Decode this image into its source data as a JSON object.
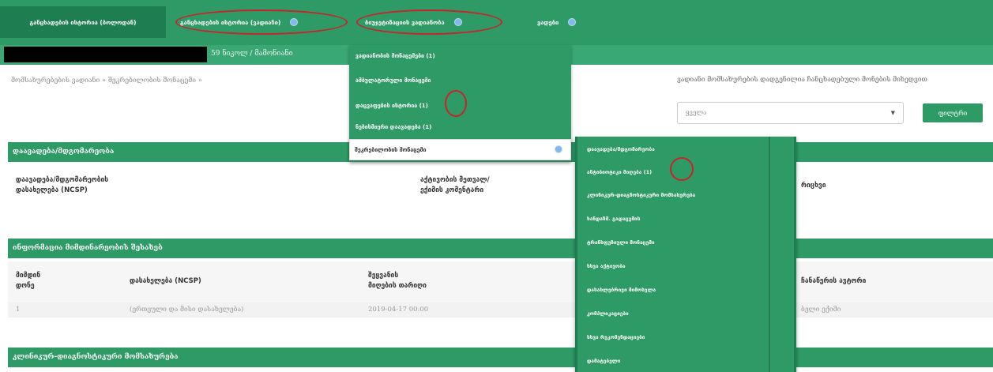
{
  "topnav": {
    "tabs": [
      {
        "label": "განცხადების ისტორია (ბოლოდან)"
      },
      {
        "label": "განცხადების ისტორია (ვადიანი)"
      },
      {
        "label": "ბიუჯეტიზაციის ვადიანობა"
      },
      {
        "label": "ვადები"
      }
    ]
  },
  "subnav": {
    "user_text": "59 ნიკოლ / მამონიანი"
  },
  "breadcrumb": "მომსახურებების ვადიანი » შეკრებილობის მონაცემი »",
  "filter": {
    "label": "ვადიანი მომსახურების დადგენილია ჩანცხადებული მონების მიხედვით",
    "select_value": "ყველა",
    "button_label": "ფილტრი"
  },
  "sections": {
    "section1_title": "დაავადება/მდგომარეობა",
    "section2_title": "ინფორმაცია მიმდინარეობის შესახებ",
    "section3_title": "კლინიკურ-დიაგნოსტიკური მომსახურება"
  },
  "section1": {
    "col1": "დაავადება/მდგომარეობის\nდასახელება (NCSP)",
    "col2": "აქტივობის მეთვალ/\nექიმის კომენტარი",
    "col3": "რიცხვი"
  },
  "section2": {
    "col1": "მიმდინ\nდონე",
    "col2": "დასახელება (NCSP)",
    "col3": "შეყვანის\nმიღების თარიღი",
    "col4": "ჩანაწერის ავტორი",
    "row": {
      "c1": "1",
      "c2": "(ერთეული და მისი დასახელება)",
      "c3": "2019-04-17 00:00",
      "c4": "ბელი ექიმი"
    }
  },
  "dropdown1": {
    "items": [
      "ვადიანობის მონაცემები (1)",
      "ამბულატორული მონაცემი",
      "დაცვაფების ისტორია (1)",
      "ნებისმიერი დაავადება (1)",
      "შეკრებილობის მონაცემი"
    ]
  },
  "dropdown2": {
    "items": [
      "დაავადება/მდგომარეობა",
      "ანტიბიოტიკი მიღება (1)",
      "კლინიკურ-დიაგნოსტიკური მომსახურება",
      "ხანდაზმ. გადაცემის",
      "ტრანსფუზიული მონაცემი",
      "სხვა აქტივობა",
      "დასახლებრივი მიმოსვლა",
      "კომპლიკაციები",
      "სხვა რეკომენდაციები",
      "დამატებელი"
    ]
  },
  "colors": {
    "nav_green": "#2e9a66",
    "nav_dark_green": "#1f7d52",
    "highlight_red": "#c8242a",
    "dot_blue": "#7fb9ef"
  }
}
